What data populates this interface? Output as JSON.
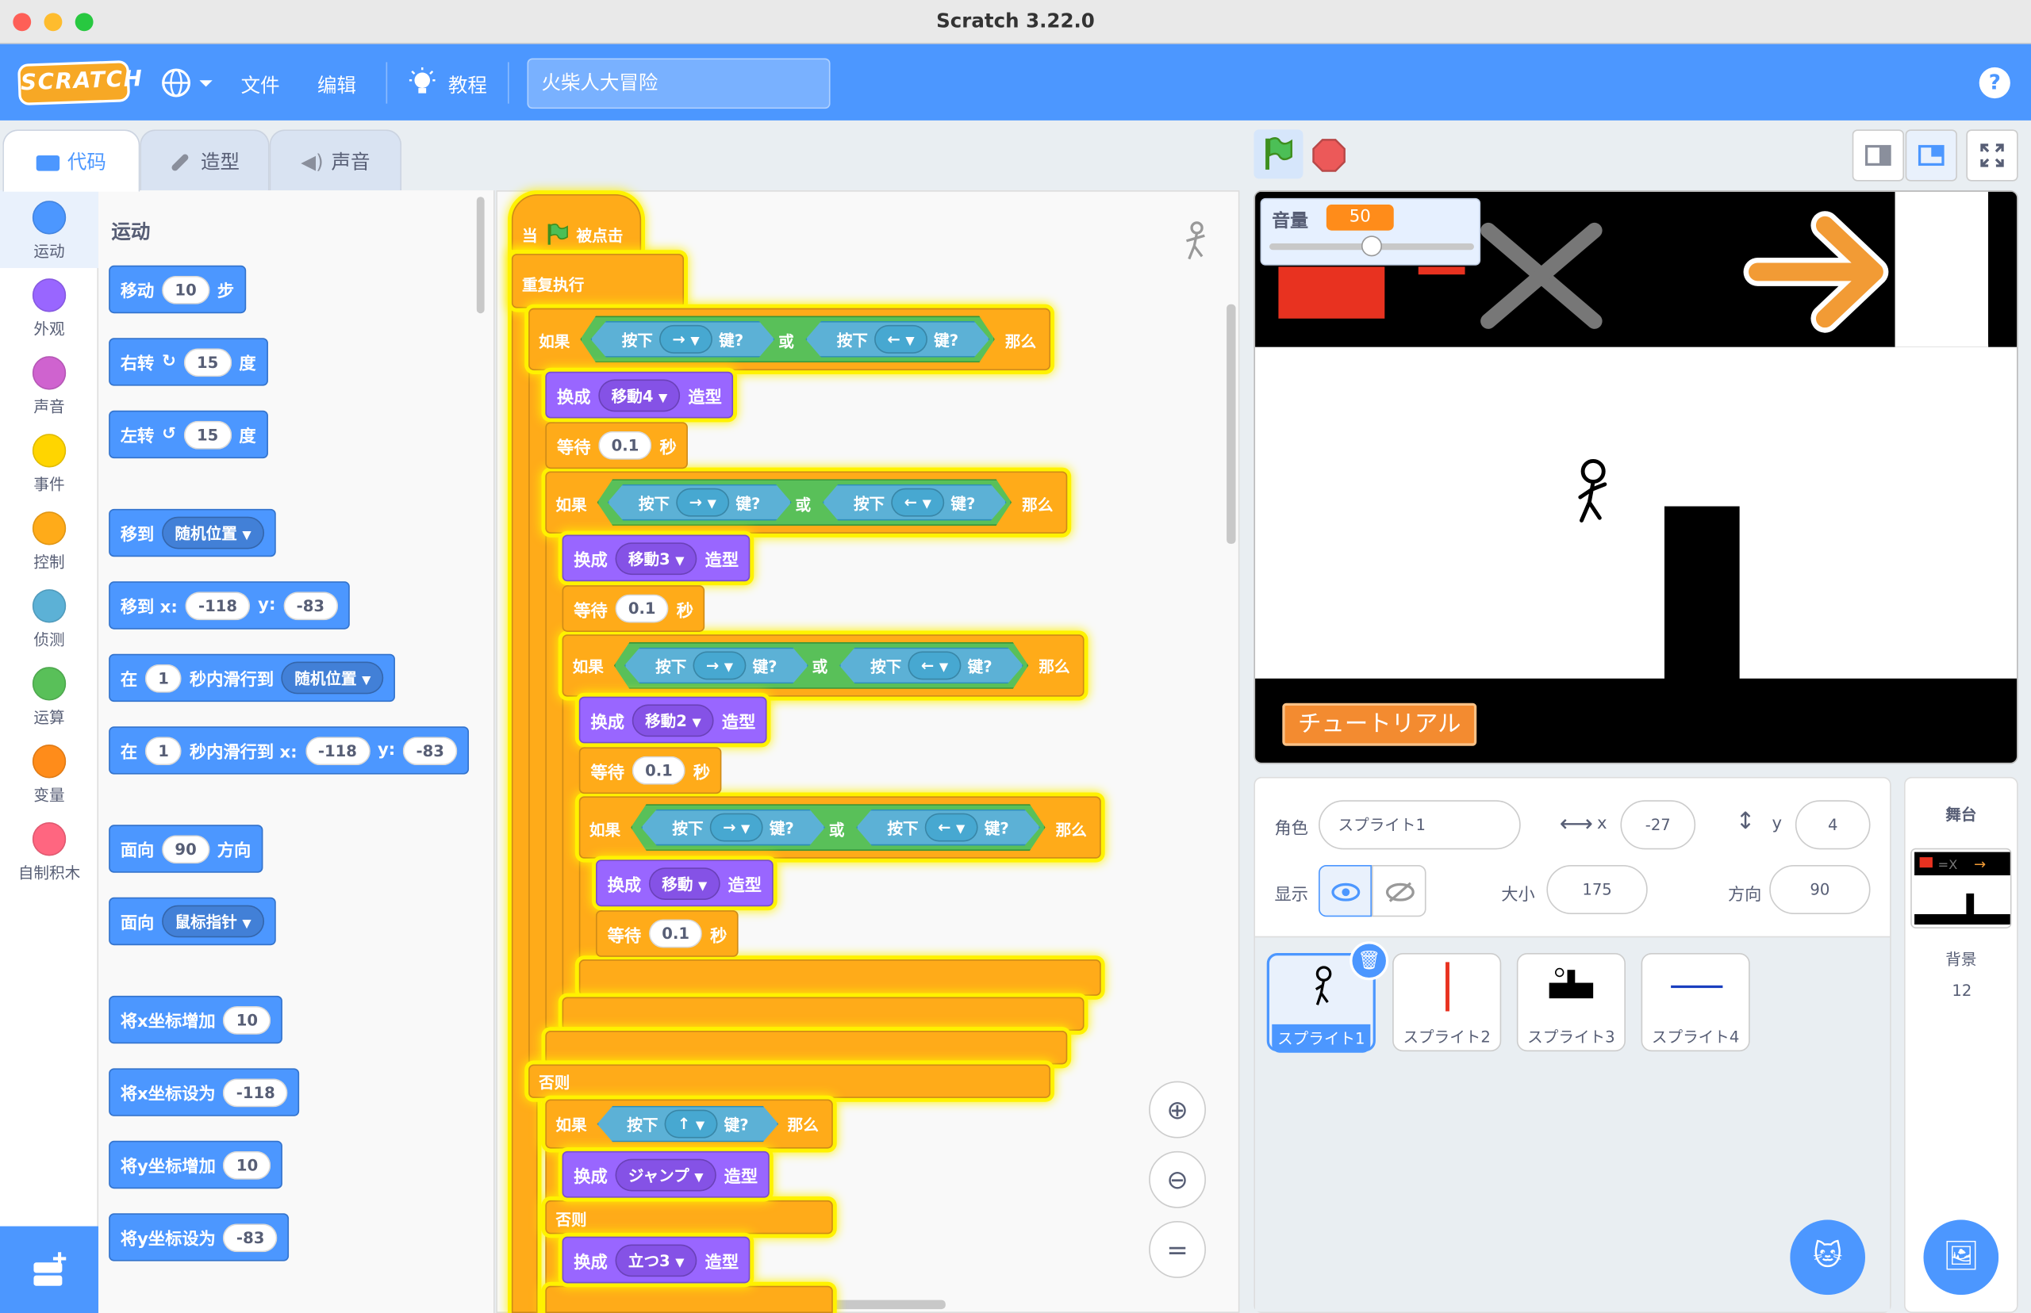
{
  "window": {
    "title": "Scratch 3.22.0"
  },
  "menu": {
    "logo": "SCRATCH",
    "file": "文件",
    "edit": "编辑",
    "tutorials": "教程",
    "project_name": "火柴人大冒险",
    "help": "?"
  },
  "tabs": {
    "code": "代码",
    "costumes": "造型",
    "sounds": "声音"
  },
  "categories": [
    {
      "label": "运动",
      "color": "#4c97ff"
    },
    {
      "label": "外观",
      "color": "#9966ff"
    },
    {
      "label": "声音",
      "color": "#cf63cf"
    },
    {
      "label": "事件",
      "color": "#ffd500"
    },
    {
      "label": "控制",
      "color": "#ffab19"
    },
    {
      "label": "侦测",
      "color": "#5cb1d6"
    },
    {
      "label": "运算",
      "color": "#59c059"
    },
    {
      "label": "变量",
      "color": "#ff8c1a"
    },
    {
      "label": "自制积木",
      "color": "#ff6680"
    }
  ],
  "palette": {
    "heading": "运动",
    "move": {
      "a": "移动",
      "v": "10",
      "b": "步"
    },
    "turn_right": {
      "a": "右转",
      "v": "15",
      "b": "度"
    },
    "turn_left": {
      "a": "左转",
      "v": "15",
      "b": "度"
    },
    "goto": {
      "a": "移到",
      "dd": "随机位置"
    },
    "gotoxy": {
      "a": "移到 x:",
      "x": "-118",
      "yl": "y:",
      "y": "-83"
    },
    "glide": {
      "a": "在",
      "v": "1",
      "b": "秒内滑行到",
      "dd": "随机位置"
    },
    "glidexy": {
      "a": "在",
      "v": "1",
      "b": "秒内滑行到 x:",
      "x": "-118",
      "yl": "y:",
      "y": "-83"
    },
    "point": {
      "a": "面向",
      "v": "90",
      "b": "方向"
    },
    "pointto": {
      "a": "面向",
      "dd": "鼠标指针"
    },
    "changex": {
      "a": "将x坐标增加",
      "v": "10"
    },
    "setx": {
      "a": "将x坐标设为",
      "v": "-118"
    },
    "changey": {
      "a": "将y坐标增加",
      "v": "10"
    },
    "sety": {
      "a": "将y坐标设为",
      "v": "-83"
    }
  },
  "script": {
    "hat": {
      "a": "当",
      "b": "被点击"
    },
    "forever": "重复执行",
    "if": "如果",
    "then": "那么",
    "or": "或",
    "press": "按下",
    "key_q": "键?",
    "right_key": "→",
    "left_key": "←",
    "up_key": "↑",
    "switch": "换成",
    "costume": "造型",
    "wait": "等待",
    "wait_val": "0.1",
    "sec": "秒",
    "else": "否则",
    "c1": "移動4",
    "c2": "移動3",
    "c3": "移動2",
    "c4": "移動",
    "c5": "ジャンプ",
    "c6": "立つ3"
  },
  "stage": {
    "volume_label": "音量",
    "volume_value": "50",
    "volume_level": 0.5,
    "tutorial_button": "チュートリアル"
  },
  "sprite_info": {
    "sprite_label": "角色",
    "sprite_name": "スプライト1",
    "x_label": "x",
    "x": "-27",
    "y_label": "y",
    "y": "4",
    "show_label": "显示",
    "size_label": "大小",
    "size": "175",
    "direction_label": "方向",
    "direction": "90"
  },
  "sprites": [
    "スプライト1",
    "スプライト2",
    "スプライト3",
    "スプライト4"
  ],
  "stage_panel": {
    "title": "舞台",
    "backdrop_label": "背景",
    "backdrop_count": "12"
  }
}
